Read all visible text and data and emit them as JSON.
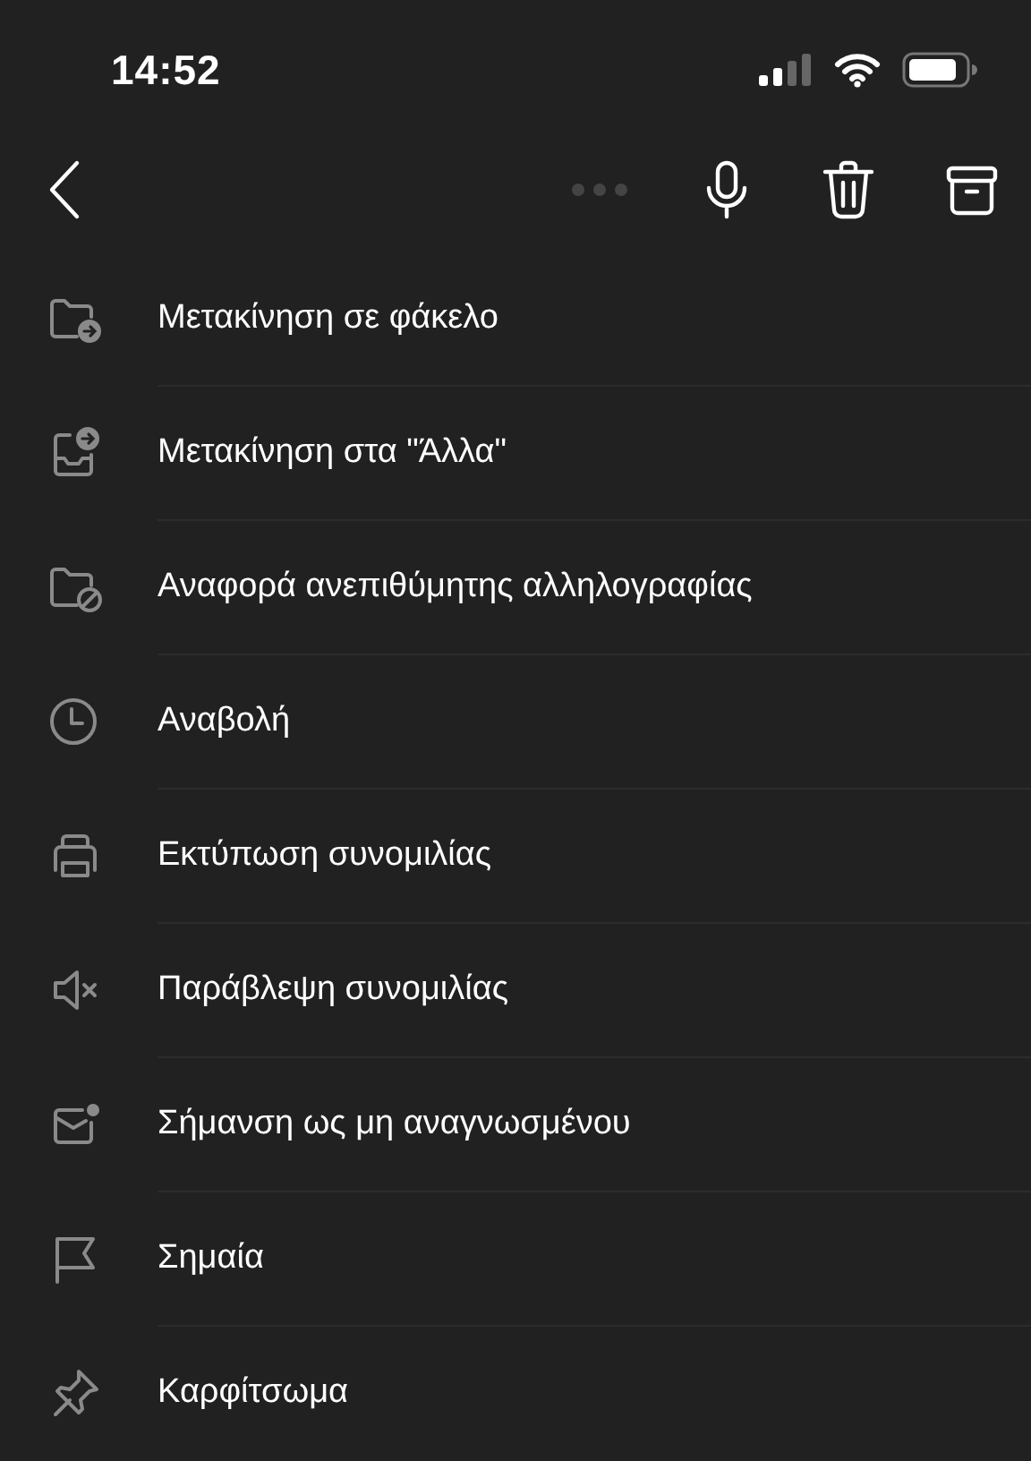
{
  "status_bar": {
    "time": "14:52"
  },
  "menu": [
    {
      "kind": "move-folder",
      "label": "Μετακίνηση σε φάκελο"
    },
    {
      "kind": "move-other",
      "label": "Μετακίνηση στα \"Άλλα\""
    },
    {
      "kind": "junk",
      "label": "Αναφορά ανεπιθύμητης αλληλογραφίας"
    },
    {
      "kind": "snooze",
      "label": "Αναβολή"
    },
    {
      "kind": "print",
      "label": "Εκτύπωση συνομιλίας"
    },
    {
      "kind": "ignore",
      "label": "Παράβλεψη συνομιλίας"
    },
    {
      "kind": "unread",
      "label": "Σήμανση ως μη αναγνωσμένου"
    },
    {
      "kind": "flag",
      "label": "Σημαία"
    },
    {
      "kind": "pin",
      "label": "Καρφίτσωμα"
    }
  ]
}
